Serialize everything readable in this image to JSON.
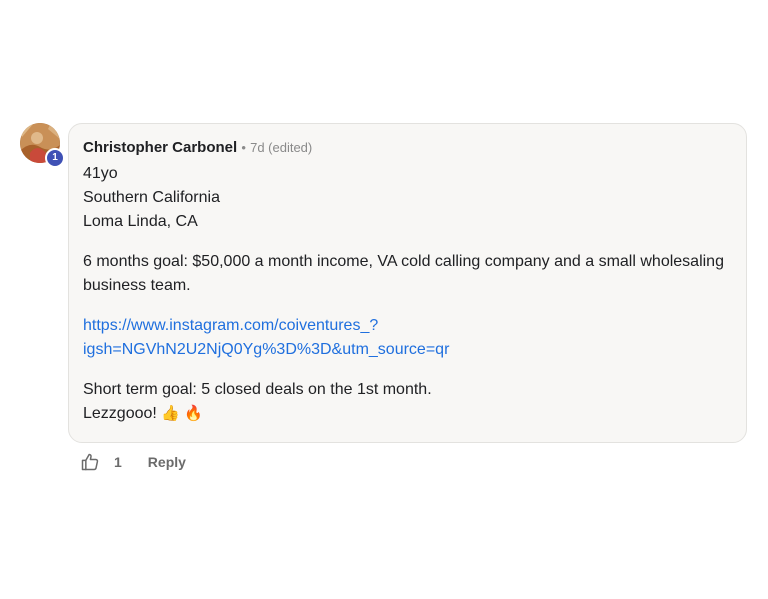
{
  "comment": {
    "author": "Christopher Carbonel",
    "separator": "•",
    "timestamp": "7d (edited)",
    "level": "1",
    "paragraphs": {
      "intro": [
        "41yo",
        "Southern California",
        "Loma Linda, CA"
      ],
      "goal": "6 months goal: $50,000 a month income, VA cold calling company and a small wholesaling business team.",
      "link_lines": [
        "https://www.instagram.com/coiventures_?",
        "igsh=NGVhN2U2NjQ0Yg%3D%3D&utm_source=qr"
      ],
      "short_term": "Short term goal: 5 closed deals on the 1st month.",
      "closing": "Lezzgooo!",
      "closing_emojis": "👍 🔥"
    }
  },
  "actions": {
    "like_icon": "thumbs-up-icon",
    "like_count": "1",
    "reply_label": "Reply"
  },
  "colors": {
    "bubble_bg": "#f8f7f5",
    "link": "#1f6fde",
    "badge": "#3f51b5"
  }
}
